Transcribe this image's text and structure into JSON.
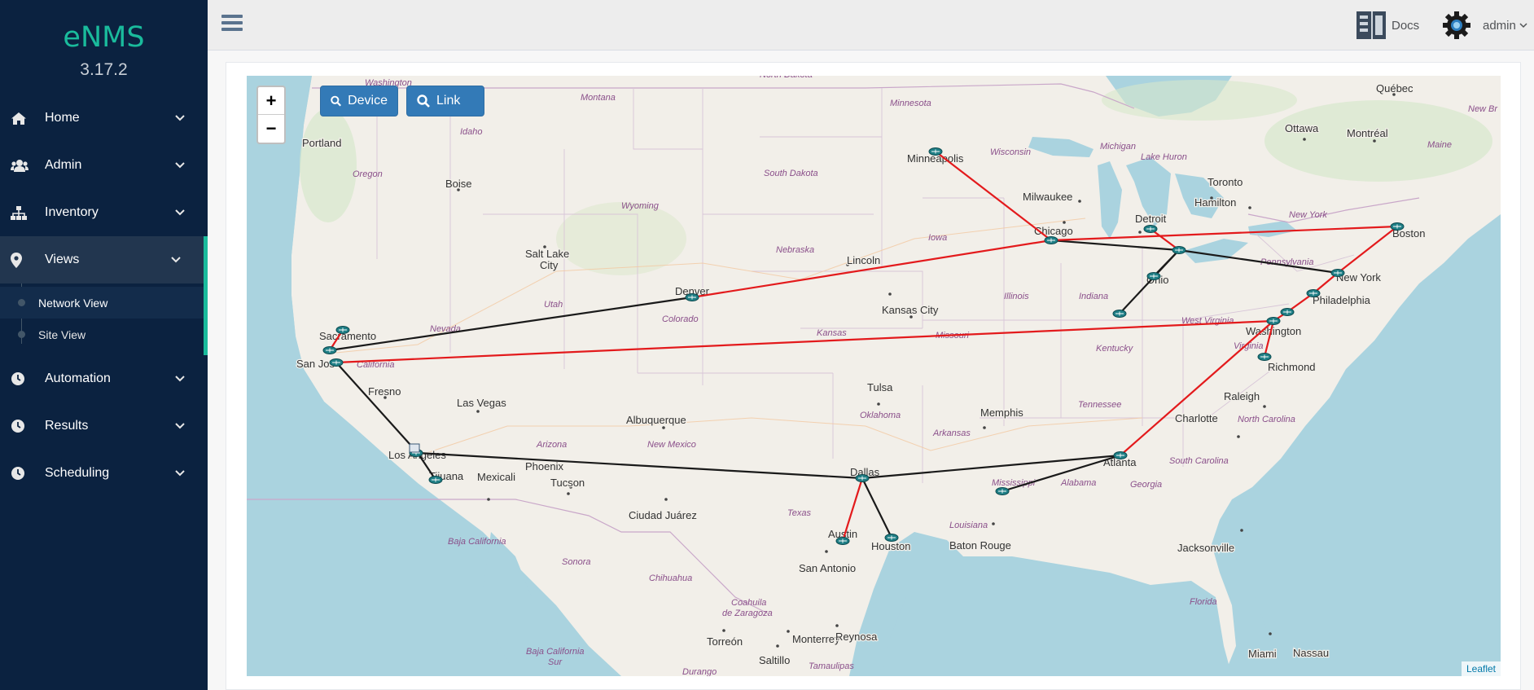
{
  "app": {
    "name": "eNMS",
    "version": "3.17.2"
  },
  "sidebar": {
    "items": [
      {
        "label": "Home",
        "icon": "home-icon"
      },
      {
        "label": "Admin",
        "icon": "users-icon"
      },
      {
        "label": "Inventory",
        "icon": "sitemap-icon"
      },
      {
        "label": "Views",
        "icon": "map-marker-icon"
      },
      {
        "label": "Automation",
        "icon": "clock-icon"
      },
      {
        "label": "Results",
        "icon": "clock-icon"
      },
      {
        "label": "Scheduling",
        "icon": "clock-icon"
      }
    ],
    "views_submenu": [
      "Network View",
      "Site View"
    ]
  },
  "topbar": {
    "docs_label": "Docs",
    "user_label": "admin"
  },
  "map": {
    "device_button": "Device",
    "link_button": "Link",
    "zoom_in": "+",
    "zoom_out": "−",
    "attribution": "Leaflet",
    "link_colors": {
      "black": "#1a1a1a",
      "red": "#e31a1c"
    },
    "cities": [
      "Portland",
      "Boise",
      "Salt Lake City",
      "Sacramento",
      "San Jose",
      "Fresno",
      "Las Vegas",
      "Los Angeles",
      "Tijuana",
      "Mexicali",
      "Phoenix",
      "Tucson",
      "Albuquerque",
      "Denver",
      "Lincoln",
      "Kansas City",
      "Minneapolis",
      "Milwaukee",
      "Chicago",
      "Detroit",
      "Ohio",
      "Toronto",
      "Hamilton",
      "Ottawa",
      "Montréal",
      "Québec",
      "Boston",
      "New York",
      "Philadelphia",
      "Washington",
      "Richmond",
      "Raleigh",
      "Charlotte",
      "Atlanta",
      "Memphis",
      "Tulsa",
      "Dallas",
      "Austin",
      "Houston",
      "San Antonio",
      "Baton Rouge",
      "Jacksonville",
      "Ciudad Juárez",
      "Torreón",
      "Monterrey",
      "Saltillo",
      "Reynosa",
      "Miami",
      "Nassau"
    ],
    "states": [
      "Washington",
      "Montana",
      "North Dakota",
      "Minnesota",
      "Idaho",
      "Oregon",
      "Wyoming",
      "South Dakota",
      "Wisconsin",
      "Michigan",
      "Lake Huron",
      "Maine",
      "New York",
      "Nevada",
      "Utah",
      "Colorado",
      "Nebraska",
      "Iowa",
      "Illinois",
      "Indiana",
      "Pennsylvania",
      "West Virginia",
      "Virginia",
      "Kansas",
      "Missouri",
      "Kentucky",
      "California",
      "Arizona",
      "New Mexico",
      "Oklahoma",
      "Arkansas",
      "Tennessee",
      "North Carolina",
      "South Carolina",
      "Georgia",
      "Alabama",
      "Mississippi",
      "Texas",
      "Louisiana",
      "Florida",
      "Baja California",
      "Sonora",
      "Chihuahua",
      "Coahuila de Zaragoza",
      "Tamaulipas",
      "Durango",
      "Baja California Sur",
      "New Br"
    ]
  }
}
